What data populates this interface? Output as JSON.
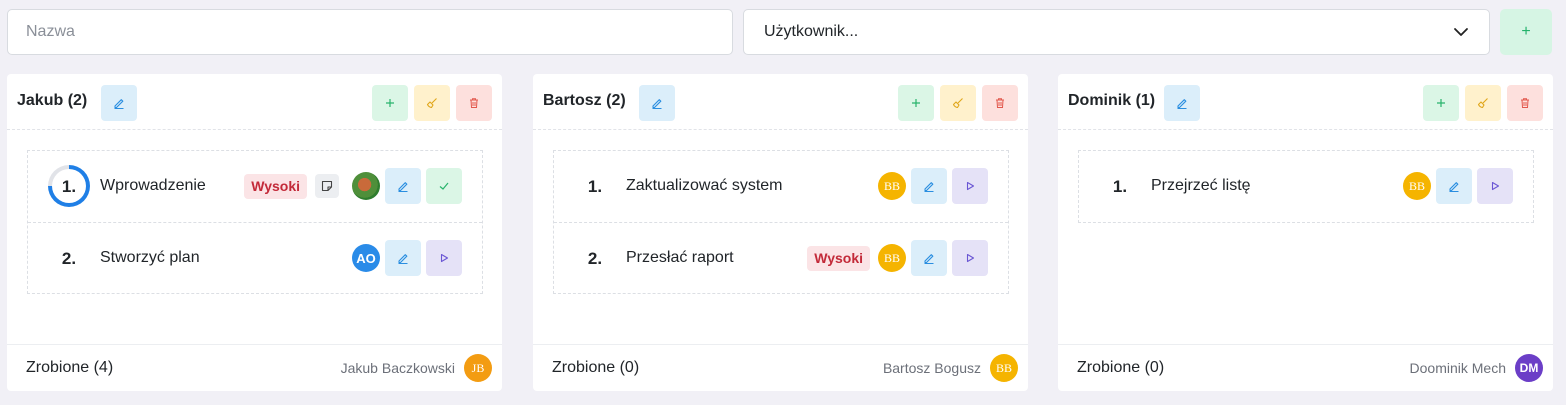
{
  "toolbar": {
    "name_placeholder": "Nazwa",
    "user_select_value": "Użytkownik...",
    "add_label": "+"
  },
  "columns": [
    {
      "title": "Jakub (2)",
      "tasks": [
        {
          "num": "1.",
          "title": "Wprowadzenie",
          "priority": "Wysoki",
          "progress_percent": 75,
          "has_note": true,
          "avatar": "image",
          "action": "check"
        },
        {
          "num": "2.",
          "title": "Stworzyć plan",
          "priority": "",
          "avatar": "AO",
          "action": "play"
        }
      ],
      "done": "Zrobione (4)",
      "owner": "Jakub Baczkowski",
      "owner_avatar": "JB"
    },
    {
      "title": "Bartosz (2)",
      "tasks": [
        {
          "num": "1.",
          "title": "Zaktualizować system",
          "priority": "",
          "avatar": "BB",
          "action": "play"
        },
        {
          "num": "2.",
          "title": "Przesłać raport",
          "priority": "Wysoki",
          "avatar": "BB",
          "action": "play"
        }
      ],
      "done": "Zrobione (0)",
      "owner": "Bartosz Bogusz",
      "owner_avatar": "BB"
    },
    {
      "title": "Dominik (1)",
      "tasks": [
        {
          "num": "1.",
          "title": "Przejrzeć listę",
          "priority": "",
          "avatar": "BB",
          "action": "play"
        }
      ],
      "done": "Zrobione (0)",
      "owner": "Doominik Mech",
      "owner_avatar": "DM"
    }
  ],
  "colors": {
    "background": "#f1f0f6",
    "priority_badge": "#c32a39",
    "progress_ring": "#1f7fe6"
  }
}
